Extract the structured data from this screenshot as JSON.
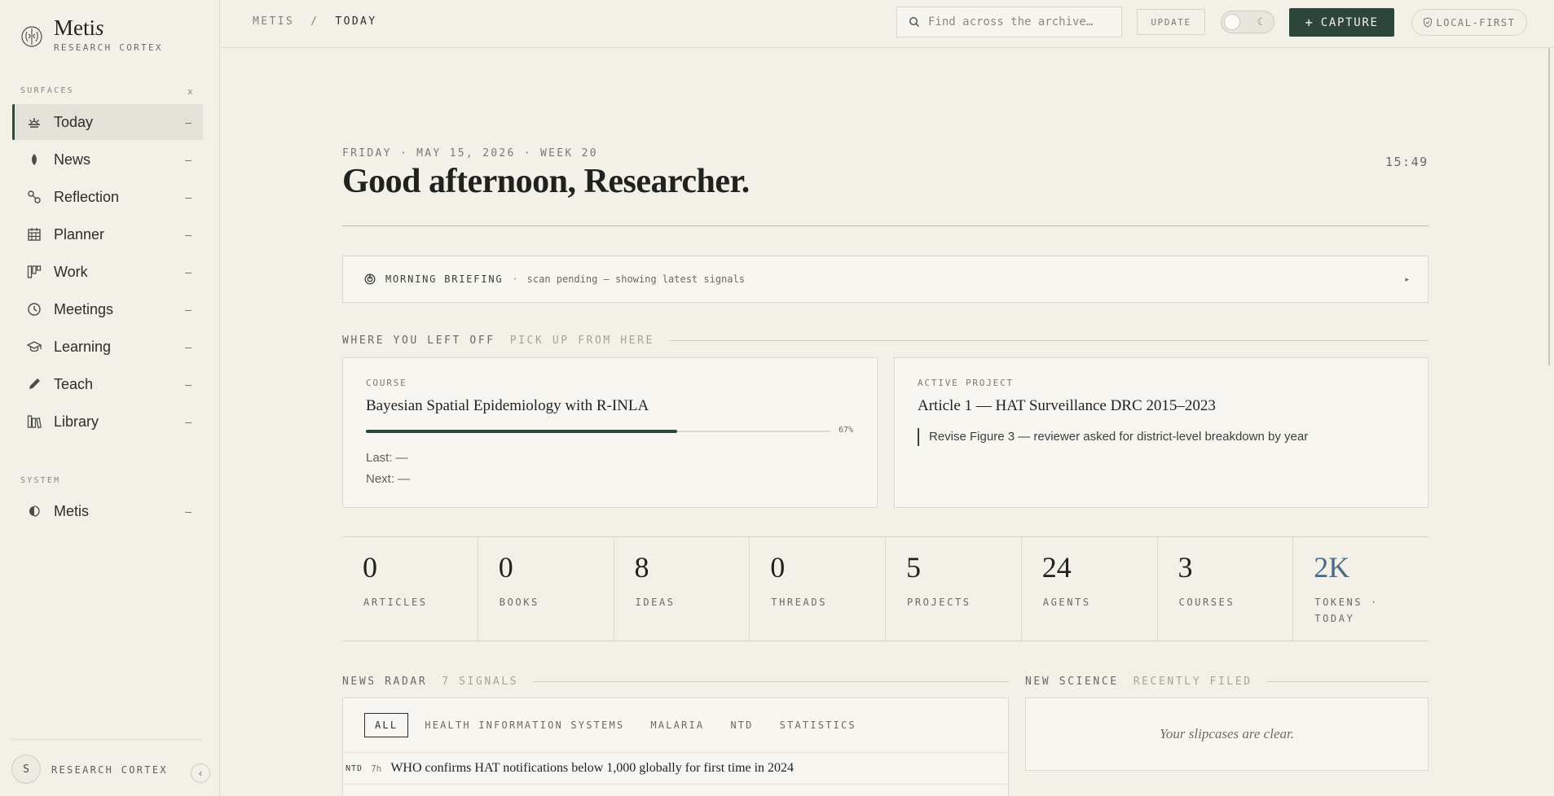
{
  "brand": {
    "name_main": "Meti",
    "name_italic": "s",
    "subtitle": "RESEARCH CORTEX"
  },
  "sidebar": {
    "surfaces_label": "SURFACES",
    "surfaces_close": "x",
    "items": [
      {
        "label": "Today",
        "icon": "sunrise-icon",
        "active": true
      },
      {
        "label": "News",
        "icon": "leaf-icon"
      },
      {
        "label": "Reflection",
        "icon": "nodes-icon"
      },
      {
        "label": "Planner",
        "icon": "calendar-icon"
      },
      {
        "label": "Work",
        "icon": "kanban-icon"
      },
      {
        "label": "Meetings",
        "icon": "clock-icon"
      },
      {
        "label": "Learning",
        "icon": "graduation-cap-icon"
      },
      {
        "label": "Teach",
        "icon": "pencil-icon"
      },
      {
        "label": "Library",
        "icon": "books-icon"
      }
    ],
    "item_marker": "–",
    "system_label": "SYSTEM",
    "system_items": [
      {
        "label": "Metis",
        "icon": "brain-icon"
      }
    ],
    "footer": {
      "avatar_initial": "S",
      "label": "RESEARCH CORTEX",
      "collapse": "‹"
    }
  },
  "topbar": {
    "breadcrumb_root": "METIS",
    "breadcrumb_sep": "/",
    "breadcrumb_current": "TODAY",
    "search_placeholder": "Find across the archive…",
    "update_label": "UPDATE",
    "capture_label": "CAPTURE",
    "capture_plus": "+",
    "local_label": "LOCAL-FIRST"
  },
  "header": {
    "dateline": "FRIDAY · MAY 15, 2026 · WEEK 20",
    "greeting": "Good afternoon, Researcher.",
    "clock": "15:49"
  },
  "briefing": {
    "title": "MORNING BRIEFING",
    "dot": "·",
    "status": "scan pending — showing latest signals",
    "arrow": "▸"
  },
  "left_off": {
    "heading": "WHERE YOU LEFT OFF",
    "subheading": "PICK UP FROM HERE",
    "course": {
      "kicker": "COURSE",
      "title": "Bayesian Spatial Epidemiology with R-INLA",
      "progress": 0.67,
      "progress_label": "67%",
      "last": "Last: —",
      "next": "Next: —"
    },
    "project": {
      "kicker": "ACTIVE PROJECT",
      "title": "Article 1 — HAT Surveillance DRC 2015–2023",
      "note": "Revise Figure 3 — reviewer asked for district-level breakdown by year"
    }
  },
  "stats": [
    {
      "value": "0",
      "label": "ARTICLES"
    },
    {
      "value": "0",
      "label": "BOOKS"
    },
    {
      "value": "8",
      "label": "IDEAS"
    },
    {
      "value": "0",
      "label": "THREADS"
    },
    {
      "value": "5",
      "label": "PROJECTS"
    },
    {
      "value": "24",
      "label": "AGENTS"
    },
    {
      "value": "3",
      "label": "COURSES"
    },
    {
      "value": "2K",
      "label": "TOKENS · TODAY"
    }
  ],
  "news_radar": {
    "heading": "NEWS RADAR",
    "subheading": "7 SIGNALS",
    "filters": [
      "ALL",
      "HEALTH INFORMATION SYSTEMS",
      "MALARIA",
      "NTD",
      "STATISTICS"
    ],
    "items": [
      {
        "tag": "NTD",
        "age": "7h",
        "headline": "WHO confirms HAT notifications below 1,000 globally for first time in 2024"
      }
    ]
  },
  "new_science": {
    "heading": "NEW SCIENCE",
    "subheading": "RECENTLY FILED",
    "empty": "Your slipcases are clear."
  },
  "colors": {
    "accent": "#2d4639",
    "background": "#f3f0e8",
    "card": "#f8f6f0",
    "tokens": "#4a6b87"
  }
}
